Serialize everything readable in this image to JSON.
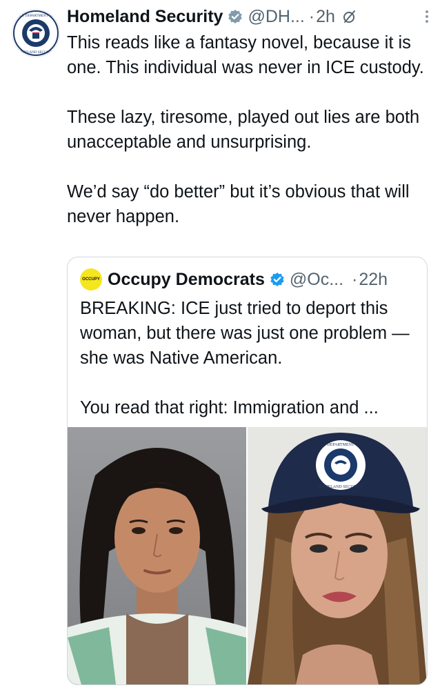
{
  "post": {
    "author_name": "Homeland Security",
    "handle": "@DH...",
    "separator": "·",
    "time": "2h",
    "paragraphs": [
      "This reads like a fantasy novel, because it is one. This individual was never in ICE custody.",
      "These lazy, tiresome, played out lies are both unacceptable and unsurprising.",
      "We’d say “do better” but it’s obvious that will never happen."
    ],
    "avatar_text_top": "U.S. DEPARTMENT OF",
    "avatar_text_bottom": "HOMELAND SECURITY"
  },
  "quoted": {
    "author_name": "Occupy Democrats",
    "handle": "@Oc...",
    "separator": "·",
    "time": "22h",
    "avatar_text": "OCCUPY",
    "paragraphs": [
      "BREAKING: ICE just tried to deport this woman, but there was just one problem — she was Native American.",
      "You read that right: Immigration and ..."
    ],
    "cap_text_top": "DEPARTMENT",
    "cap_text_bottom": "HOMELAND SECURITY"
  },
  "colors": {
    "verified": "#1d9bf0",
    "secondary_text": "#536471",
    "border": "#cfd9de",
    "occupy_yellow": "#f5e61e"
  },
  "icons": [
    "verified-badge-icon",
    "grok-icon",
    "more-options-icon"
  ]
}
